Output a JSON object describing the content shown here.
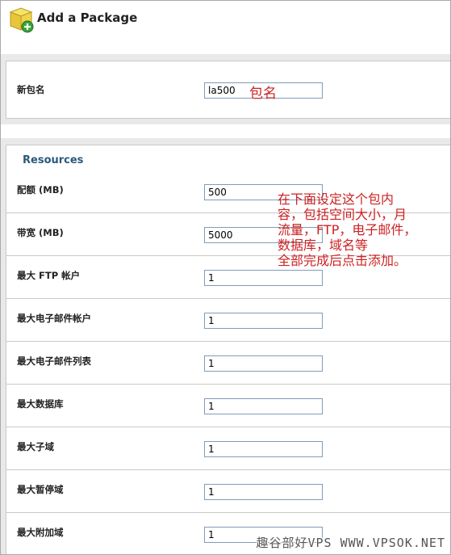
{
  "header": {
    "title": "Add a Package",
    "icon": "package-add-icon"
  },
  "name_section": {
    "label": "新包名",
    "value": "la500",
    "annotation": "包名"
  },
  "resources": {
    "title": "Resources",
    "fields": [
      {
        "label": "配额 (MB)",
        "value": "500"
      },
      {
        "label": "带宽 (MB)",
        "value": "5000"
      },
      {
        "label": "最大 FTP 帐户",
        "value": "1"
      },
      {
        "label": "最大电子邮件帐户",
        "value": "1"
      },
      {
        "label": "最大电子邮件列表",
        "value": "1"
      },
      {
        "label": "最大数据库",
        "value": "1"
      },
      {
        "label": "最大子域",
        "value": "1"
      },
      {
        "label": "最大暂停域",
        "value": "1"
      },
      {
        "label": "最大附加域",
        "value": "1"
      }
    ]
  },
  "annotation_note": {
    "lines": [
      "在下面设定这个包内",
      "容，包括空间大小，月",
      "流量，FTP，电子邮件，",
      "数据库，域名等",
      "全部完成后点击添加。"
    ]
  },
  "watermark": "趣谷部好VPS WWW.VPSOK.NET",
  "colors": {
    "section_title": "#2a5a7a",
    "annotation": "#cc2222",
    "border": "#c9c9c9",
    "band": "#e9e9e9"
  }
}
